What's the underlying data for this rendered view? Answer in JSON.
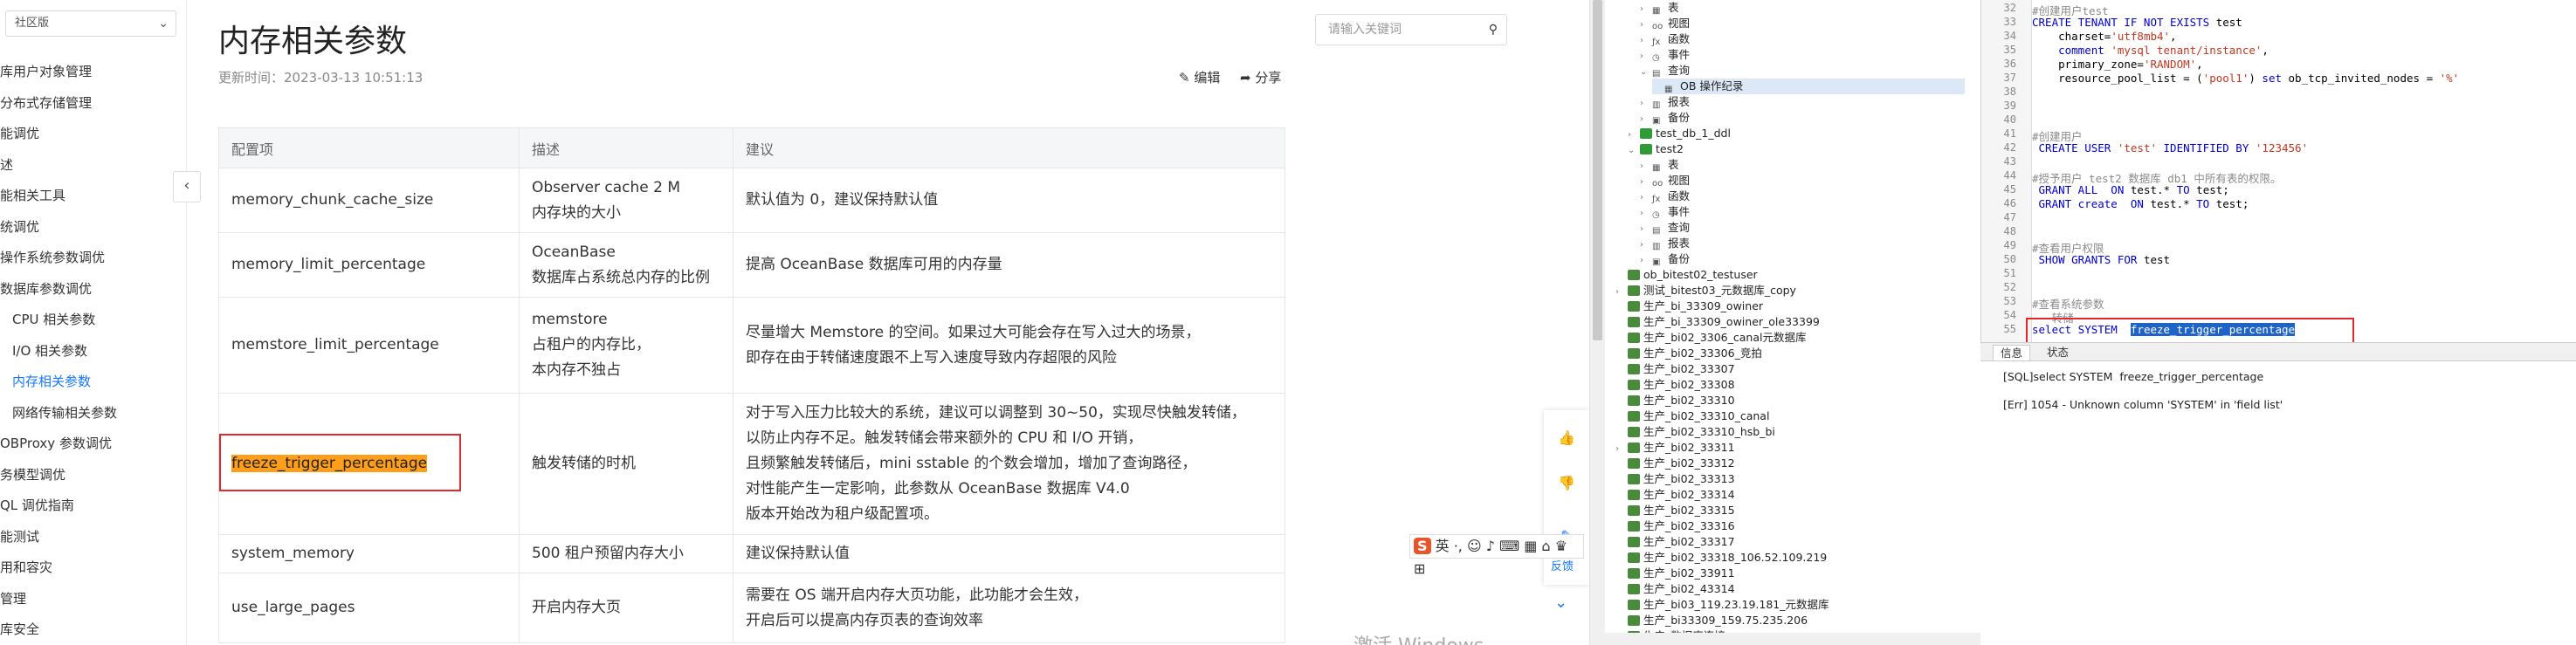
{
  "doc": {
    "edition": "社区版",
    "nav_items": [
      {
        "label": "库用户对象管理",
        "active": false
      },
      {
        "label": "分布式存储管理",
        "active": false
      },
      {
        "label": "能调优",
        "active": false
      },
      {
        "label": "述",
        "active": false
      },
      {
        "label": "能相关工具",
        "active": false
      },
      {
        "label": "统调优",
        "active": false
      },
      {
        "label": "操作系统参数调优",
        "active": false
      },
      {
        "label": "数据库参数调优",
        "active": false
      },
      {
        "label": "CPU 相关参数",
        "active": false
      },
      {
        "label": "I/O 相关参数",
        "active": false
      },
      {
        "label": "内存相关参数",
        "active": true
      },
      {
        "label": "网络传输相关参数",
        "active": false
      },
      {
        "label": "OBProxy 参数调优",
        "active": false
      },
      {
        "label": "务模型调优",
        "active": false
      },
      {
        "label": "QL 调优指南",
        "active": false
      },
      {
        "label": "能测试",
        "active": false
      },
      {
        "label": "用和容灾",
        "active": false
      },
      {
        "label": "管理",
        "active": false
      },
      {
        "label": "库安全",
        "active": false
      }
    ],
    "title": "内存相关参数",
    "update_time": "更新时间：2023-03-13 10:51:13",
    "search_placeholder": "请输入关键词",
    "edit_label": "编辑",
    "share_label": "分享",
    "table": {
      "headers": [
        "配置项",
        "描述",
        "建议"
      ],
      "rows": [
        {
          "name": "memory_chunk_cache_size",
          "desc": [
            "Observer cache 2 M",
            "内存块的大小"
          ],
          "advice": [
            "默认值为 0，建议保持默认值"
          ]
        },
        {
          "name": "memory_limit_percentage",
          "desc": [
            "OceanBase",
            "数据库占系统总内存的比例"
          ],
          "advice": [
            "提高 OceanBase 数据库可用的内存量"
          ]
        },
        {
          "name": "memstore_limit_percentage",
          "desc": [
            "memstore",
            "占租户的内存比，",
            "本内存不独占"
          ],
          "advice": [
            "尽量增大 Memstore 的空间。如果过大可能会存在写入过大的场景，",
            "即存在由于转储速度跟不上写入速度导致内存超限的风险"
          ]
        },
        {
          "name": "freeze_trigger_percentage",
          "desc": [
            "触发转储的时机"
          ],
          "advice": [
            "对于写入压力比较大的系统，建议可以调整到 30~50，实现尽快触发转储，",
            "以防止内存不足。触发转储会带来额外的 CPU 和 I/O 开销，",
            "且频繁触发转储后，mini sstable 的个数会增加，增加了查询路径，",
            "对性能产生一定影响，此参数从 OceanBase 数据库 V4.0",
            "版本开始改为租户级配置项。"
          ]
        },
        {
          "name": "system_memory",
          "desc": [
            "500 租户预留内存大小"
          ],
          "advice": [
            "建议保持默认值"
          ]
        },
        {
          "name": "use_large_pages",
          "desc": [
            "开启内存大页"
          ],
          "advice": [
            "需要在 OS 端开启内存大页功能，此功能才会生效，",
            "开启后可以提高内存页表的查询效率"
          ]
        }
      ]
    },
    "feedback_label": "反馈",
    "ime_text": "英 ·, ☺ ♪ ⌨ ▦ ⌂ ♛ ⊞",
    "watermark": "激活 Windows"
  },
  "tree": {
    "rows": [
      {
        "indent": 2,
        "twisty": "›",
        "icon": "grid",
        "label": "表"
      },
      {
        "indent": 2,
        "twisty": "›",
        "icon": "view",
        "label": "视图"
      },
      {
        "indent": 2,
        "twisty": "›",
        "icon": "func",
        "label": "函数"
      },
      {
        "indent": 2,
        "twisty": "›",
        "icon": "event",
        "label": "事件"
      },
      {
        "indent": 2,
        "twisty": "⌄",
        "icon": "query",
        "label": "查询"
      },
      {
        "indent": 3,
        "twisty": "",
        "icon": "grid",
        "label": "OB 操作纪录",
        "selected": true
      },
      {
        "indent": 2,
        "twisty": "›",
        "icon": "report",
        "label": "报表"
      },
      {
        "indent": 2,
        "twisty": "›",
        "icon": "backup",
        "label": "备份"
      },
      {
        "indent": 1,
        "twisty": "›",
        "icon": "db",
        "label": "test_db_1_ddl"
      },
      {
        "indent": 1,
        "twisty": "⌄",
        "icon": "db",
        "label": "test2"
      },
      {
        "indent": 2,
        "twisty": "›",
        "icon": "grid",
        "label": "表"
      },
      {
        "indent": 2,
        "twisty": "›",
        "icon": "view",
        "label": "视图"
      },
      {
        "indent": 2,
        "twisty": "›",
        "icon": "func",
        "label": "函数"
      },
      {
        "indent": 2,
        "twisty": "›",
        "icon": "event",
        "label": "事件"
      },
      {
        "indent": 2,
        "twisty": "›",
        "icon": "query",
        "label": "查询"
      },
      {
        "indent": 2,
        "twisty": "›",
        "icon": "report",
        "label": "报表"
      },
      {
        "indent": 2,
        "twisty": "›",
        "icon": "backup",
        "label": "备份"
      },
      {
        "indent": 0,
        "twisty": "",
        "icon": "conn",
        "label": "ob_bitest02_testuser"
      },
      {
        "indent": 0,
        "twisty": "›",
        "icon": "conn",
        "label": "测试_bitest03_元数据库_copy"
      },
      {
        "indent": 0,
        "twisty": "",
        "icon": "conn",
        "label": "生产_bi_33309_owiner"
      },
      {
        "indent": 0,
        "twisty": "",
        "icon": "conn",
        "label": "生产_bi_33309_owiner_ole33399"
      },
      {
        "indent": 0,
        "twisty": "",
        "icon": "conn",
        "label": "生产_bi02_3306_canal元数据库"
      },
      {
        "indent": 0,
        "twisty": "",
        "icon": "conn",
        "label": "生产_bi02_33306_竞拍"
      },
      {
        "indent": 0,
        "twisty": "",
        "icon": "conn",
        "label": "生产_bi02_33307"
      },
      {
        "indent": 0,
        "twisty": "",
        "icon": "conn",
        "label": "生产_bi02_33308"
      },
      {
        "indent": 0,
        "twisty": "",
        "icon": "conn",
        "label": "生产_bi02_33310"
      },
      {
        "indent": 0,
        "twisty": "",
        "icon": "conn",
        "label": "生产_bi02_33310_canal"
      },
      {
        "indent": 0,
        "twisty": "",
        "icon": "conn",
        "label": "生产_bi02_33310_hsb_bi"
      },
      {
        "indent": 0,
        "twisty": "›",
        "icon": "conn",
        "label": "生产_bi02_33311"
      },
      {
        "indent": 0,
        "twisty": "",
        "icon": "conn",
        "label": "生产_bi02_33312"
      },
      {
        "indent": 0,
        "twisty": "",
        "icon": "conn",
        "label": "生产_bi02_33313"
      },
      {
        "indent": 0,
        "twisty": "",
        "icon": "conn",
        "label": "生产_bi02_33314"
      },
      {
        "indent": 0,
        "twisty": "",
        "icon": "conn",
        "label": "生产_bi02_33315"
      },
      {
        "indent": 0,
        "twisty": "",
        "icon": "conn",
        "label": "生产_bi02_33316"
      },
      {
        "indent": 0,
        "twisty": "",
        "icon": "conn",
        "label": "生产_bi02_33317"
      },
      {
        "indent": 0,
        "twisty": "",
        "icon": "conn",
        "label": "生产_bi02_33318_106.52.109.219"
      },
      {
        "indent": 0,
        "twisty": "",
        "icon": "conn",
        "label": "生产_bi02_33911"
      },
      {
        "indent": 0,
        "twisty": "",
        "icon": "conn",
        "label": "生产_bi02_43314"
      },
      {
        "indent": 0,
        "twisty": "",
        "icon": "conn",
        "label": "生产_bi03_119.23.19.181_元数据库"
      },
      {
        "indent": 0,
        "twisty": "",
        "icon": "conn",
        "label": "生产_bi33309_159.75.235.206"
      },
      {
        "indent": 0,
        "twisty": "",
        "icon": "conn",
        "label": "生产_数据库连接"
      }
    ]
  },
  "editor": {
    "lines": [
      {
        "n": "32",
        "parts": [
          {
            "t": "#创建用户test",
            "c": "cm"
          }
        ]
      },
      {
        "n": "33",
        "parts": [
          {
            "t": "CREATE TENANT IF NOT EXISTS ",
            "c": "kw"
          },
          {
            "t": "test",
            "c": ""
          }
        ]
      },
      {
        "n": "34",
        "parts": [
          {
            "t": "    charset=",
            "c": ""
          },
          {
            "t": "'utf8mb4'",
            "c": "st"
          },
          {
            "t": ",",
            "c": ""
          }
        ]
      },
      {
        "n": "35",
        "parts": [
          {
            "t": "    comment ",
            "c": "kw"
          },
          {
            "t": "'mysql tenant/instance'",
            "c": "st"
          },
          {
            "t": ",",
            "c": ""
          }
        ]
      },
      {
        "n": "36",
        "parts": [
          {
            "t": "    primary_zone=",
            "c": ""
          },
          {
            "t": "'RANDOM'",
            "c": "st"
          },
          {
            "t": ",",
            "c": ""
          }
        ]
      },
      {
        "n": "37",
        "parts": [
          {
            "t": "    resource_pool_list = (",
            "c": ""
          },
          {
            "t": "'pool1'",
            "c": "st"
          },
          {
            "t": ") ",
            "c": ""
          },
          {
            "t": "set",
            "c": "kw"
          },
          {
            "t": " ob_tcp_invited_nodes = ",
            "c": ""
          },
          {
            "t": "'%'",
            "c": "st"
          }
        ]
      },
      {
        "n": "38",
        "parts": []
      },
      {
        "n": "39",
        "parts": []
      },
      {
        "n": "40",
        "parts": []
      },
      {
        "n": "41",
        "parts": [
          {
            "t": "#创建用户",
            "c": "cm"
          }
        ]
      },
      {
        "n": "42",
        "parts": [
          {
            "t": " CREATE USER ",
            "c": "kw"
          },
          {
            "t": "'test'",
            "c": "st"
          },
          {
            "t": " IDENTIFIED BY ",
            "c": "kw"
          },
          {
            "t": "'123456'",
            "c": "st"
          }
        ]
      },
      {
        "n": "43",
        "parts": []
      },
      {
        "n": "44",
        "parts": [
          {
            "t": "#授予用户 test2 数据库 db1 中所有表的权限。",
            "c": "cm"
          }
        ]
      },
      {
        "n": "45",
        "parts": [
          {
            "t": " GRANT ALL  ON ",
            "c": "kw"
          },
          {
            "t": "test.* ",
            "c": ""
          },
          {
            "t": "TO",
            "c": "kw"
          },
          {
            "t": " test;",
            "c": ""
          }
        ]
      },
      {
        "n": "46",
        "parts": [
          {
            "t": " GRANT create  ON ",
            "c": "kw"
          },
          {
            "t": "test.* ",
            "c": ""
          },
          {
            "t": "TO",
            "c": "kw"
          },
          {
            "t": " test;",
            "c": ""
          }
        ]
      },
      {
        "n": "47",
        "parts": []
      },
      {
        "n": "48",
        "parts": []
      },
      {
        "n": "49",
        "parts": [
          {
            "t": "#查看用户权限",
            "c": "cm"
          }
        ]
      },
      {
        "n": "50",
        "parts": [
          {
            "t": " SHOW GRANTS FOR ",
            "c": "kw"
          },
          {
            "t": "test",
            "c": ""
          }
        ]
      },
      {
        "n": "51",
        "parts": []
      },
      {
        "n": "52",
        "parts": []
      },
      {
        "n": "53",
        "parts": [
          {
            "t": "#查看系统参数",
            "c": "cm"
          }
        ]
      },
      {
        "n": "54",
        "parts": [
          {
            "t": "-- 转储",
            "c": "cm"
          }
        ]
      },
      {
        "n": "55",
        "parts": [
          {
            "t": "select SYSTEM  ",
            "c": "kw"
          },
          {
            "t": "freeze_trigger_percentage",
            "c": "selhl"
          }
        ]
      }
    ],
    "result_tabs": [
      {
        "label": "信息",
        "active": true
      },
      {
        "label": "状态",
        "active": false
      }
    ],
    "result_lines": [
      "[SQL]select SYSTEM  freeze_trigger_percentage",
      "",
      "[Err] 1054 - Unknown column 'SYSTEM' in 'field list'"
    ]
  }
}
